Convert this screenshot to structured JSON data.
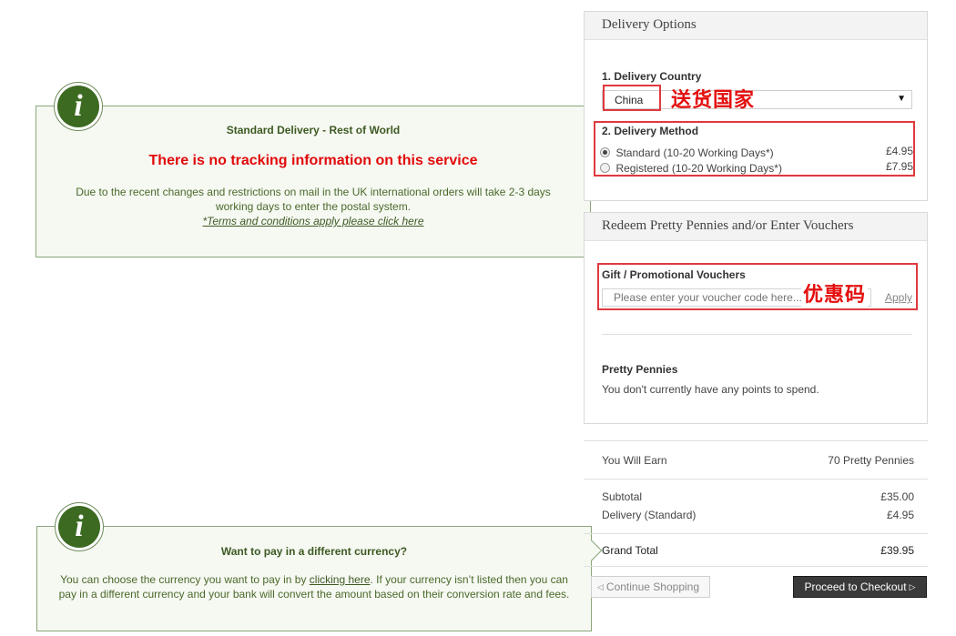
{
  "shipping_tip": {
    "title": "Standard Delivery - Rest of World",
    "warning": "There is no tracking information on this service",
    "body": "Due to the recent changes and restrictions on mail in the UK international orders will take 2-3 days working days to enter the postal system.",
    "terms_link": "*Terms and conditions apply please click here",
    "icon": "info-icon"
  },
  "currency_tip": {
    "title": "Want to pay in a different currency?",
    "body_before": "You can choose the currency you want to pay in by ",
    "link": "clicking here",
    "body_after": ". If your currency isn’t listed then you can pay in a different currency and your bank will convert the amount based on their conversion rate and fees.",
    "icon": "info-icon"
  },
  "delivery": {
    "heading": "Delivery Options",
    "country_label": "1. Delivery Country",
    "country_value": "China",
    "country_note": "送货国家",
    "method_label": "2. Delivery Method",
    "methods": [
      {
        "label": "Standard (10-20 Working Days*)",
        "price": "£4.95",
        "selected": true
      },
      {
        "label": "Registered (10-20 Working Days*)",
        "price": "£7.95",
        "selected": false
      }
    ]
  },
  "vouchers": {
    "heading": "Redeem Pretty Pennies and/or Enter Vouchers",
    "label": "Gift / Promotional Vouchers",
    "placeholder": "Please enter your voucher code here...",
    "note": "优惠码",
    "apply": "Apply",
    "pennies_title": "Pretty Pennies",
    "pennies_text": "You don't currently have any points to spend."
  },
  "summary": {
    "earn_label": "You Will Earn",
    "earn_value": "70 Pretty Pennies",
    "subtotal_label": "Subtotal",
    "subtotal_value": "£35.00",
    "delivery_label": "Delivery (Standard)",
    "delivery_value": "£4.95",
    "total_label": "Grand Total",
    "total_value": "£39.95"
  },
  "actions": {
    "continue": "Continue Shopping",
    "checkout": "Proceed to Checkout"
  },
  "colors": {
    "accent_green": "#3b6a20",
    "annotation_red": "#e0393e",
    "checkout_bg": "#3a3a3a"
  }
}
